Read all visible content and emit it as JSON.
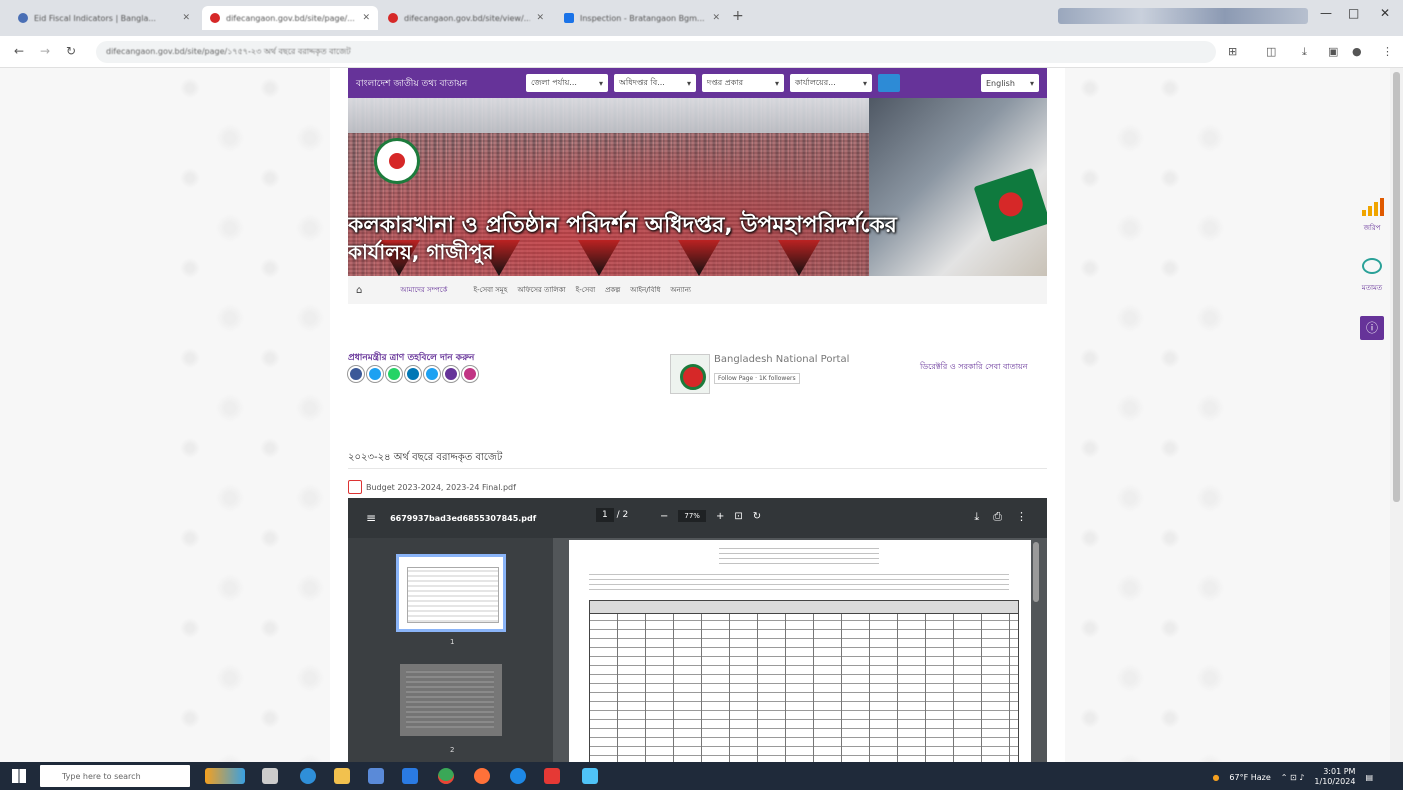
{
  "browser": {
    "tabs": [
      {
        "title": "Eid Fiscal Indicators | Bangla...",
        "active": false
      },
      {
        "title": "difecangaon.gov.bd/site/page/...",
        "active": true
      },
      {
        "title": "difecangaon.gov.bd/site/view/...",
        "active": false
      },
      {
        "title": "Inspection - Bratangaon Bgm...",
        "active": false
      }
    ],
    "url": "difecangaon.gov.bd/site/page/১৭৫৭-২৩ অর্থ বছরে বরাদ্দকৃত বাজেট",
    "controls": {
      "minimize": "—",
      "maximize": "□",
      "close": "✕"
    }
  },
  "site": {
    "name": "বাংলাদেশ জাতীয় তথ্য বাতায়ন",
    "selects": [
      "জেলা পর্যায়...",
      "অধিদপ্তর বি...",
      "দপ্তর প্রকার",
      "কার্যালয়ের..."
    ],
    "language": "English",
    "title": "কলকারখানা ও প্রতিষ্ঠান পরিদর্শন অধিদপ্তর, উপমহাপরিদর্শকের",
    "subtitle": "কার্যালয়, গাজীপুর"
  },
  "menu": {
    "items": [
      "আমাদের সম্পর্কে",
      "ই-সেবা সমূহ",
      "অফিসের তালিকা",
      "ই-সেবা",
      "প্রকল্প",
      "আইন/বিধি",
      "অন্যান্য"
    ],
    "active_index": 0
  },
  "widgets": {
    "pm_relief": "প্রধানমন্ত্রীর ত্রাণ তহবিলে দান করুন",
    "social_colors": [
      "#3b5998",
      "#1da1f2",
      "#25d366",
      "#0077b5",
      "#1da1f2",
      "#663399",
      "#c13584"
    ],
    "portal_name": "Bangladesh National Portal",
    "portal_follow": "Follow Page · 1K followers",
    "directory_link": "ডিরেক্টরি ও সরকারি সেবা বাতায়ন"
  },
  "content": {
    "heading": "২০২৩-২৪ অর্থ বছরে বরাদ্দকৃত বাজেট",
    "pdf_link": "Budget 2023-2024, 2023-24 Final.pdf"
  },
  "pdf_viewer": {
    "filename": "6679937bad3ed6855307845.pdf",
    "page": "1",
    "total": "/ 2",
    "zoom": "77%",
    "thumb_pages": [
      "1",
      "2"
    ]
  },
  "side": {
    "stats_label": "জরিপ",
    "chat_label": "মতামত"
  },
  "taskbar": {
    "search_placeholder": "Type here to search",
    "weather": "67°F Haze",
    "time": "3:01 PM",
    "date": "1/10/2024"
  }
}
